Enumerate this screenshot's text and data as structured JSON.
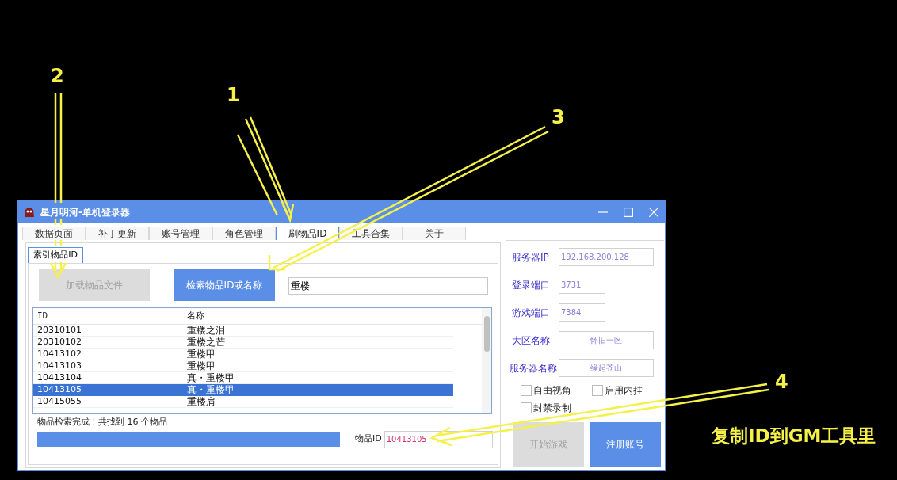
{
  "annotations": [
    {
      "label": "2"
    },
    {
      "label": "1"
    },
    {
      "label": "3"
    },
    {
      "label": "4"
    }
  ],
  "caption": "复制ID到GM工具里",
  "window": {
    "title": "星月明河-单机登录器"
  },
  "tabs": [
    {
      "label": "数据页面",
      "selected": false
    },
    {
      "label": "补丁更新",
      "selected": false
    },
    {
      "label": "账号管理",
      "selected": false
    },
    {
      "label": "角色管理",
      "selected": false
    },
    {
      "label": "刷物品ID",
      "selected": true
    },
    {
      "label": "工具合集",
      "selected": false
    },
    {
      "label": "关于",
      "selected": false
    }
  ],
  "subtab": {
    "label": "索引物品ID",
    "selected": true
  },
  "load_button": {
    "label": "加载物品文件",
    "disabled": true
  },
  "search_button": {
    "label": "检索物品ID或名称",
    "disabled": false
  },
  "search_field": {
    "value": "重楼"
  },
  "table": {
    "columns": [
      "ID",
      "名称"
    ],
    "rows": [
      {
        "id": "20310101",
        "name": "重楼之泪",
        "selected": false
      },
      {
        "id": "20310102",
        "name": "重楼之芒",
        "selected": false
      },
      {
        "id": "10413102",
        "name": "重楼甲",
        "selected": false
      },
      {
        "id": "10413103",
        "name": "重楼甲",
        "selected": false
      },
      {
        "id": "10413104",
        "name": "真・重楼甲",
        "selected": false
      },
      {
        "id": "10413105",
        "name": "真・重楼甲",
        "selected": true
      },
      {
        "id": "10415055",
        "name": "重楼肩",
        "selected": false
      }
    ]
  },
  "status": "物品检索完成！共找到 16 个物品",
  "progress": {
    "level": 1
  },
  "item_id": {
    "label": "物品ID",
    "value": "10413105"
  },
  "server_fields": [
    {
      "label": "服务器IP",
      "value": "192.168.200.128",
      "kind": "wide"
    },
    {
      "label": "登录端口",
      "value": "3731",
      "kind": "narrow"
    },
    {
      "label": "游戏端口",
      "value": "7384",
      "kind": "narrow"
    },
    {
      "label": "大区名称",
      "value": "怀旧一区",
      "kind": "centered"
    },
    {
      "label": "服务器名称",
      "value": "缘起苍山",
      "kind": "centered"
    }
  ],
  "options": [
    {
      "label": "自由视角",
      "checked": false
    },
    {
      "label": "启用内挂",
      "checked": false
    },
    {
      "label": "封禁录制",
      "checked": false
    }
  ],
  "start_button": {
    "label": "开始游戏",
    "disabled": true
  },
  "register_button": {
    "label": "注册账号",
    "disabled": false
  }
}
